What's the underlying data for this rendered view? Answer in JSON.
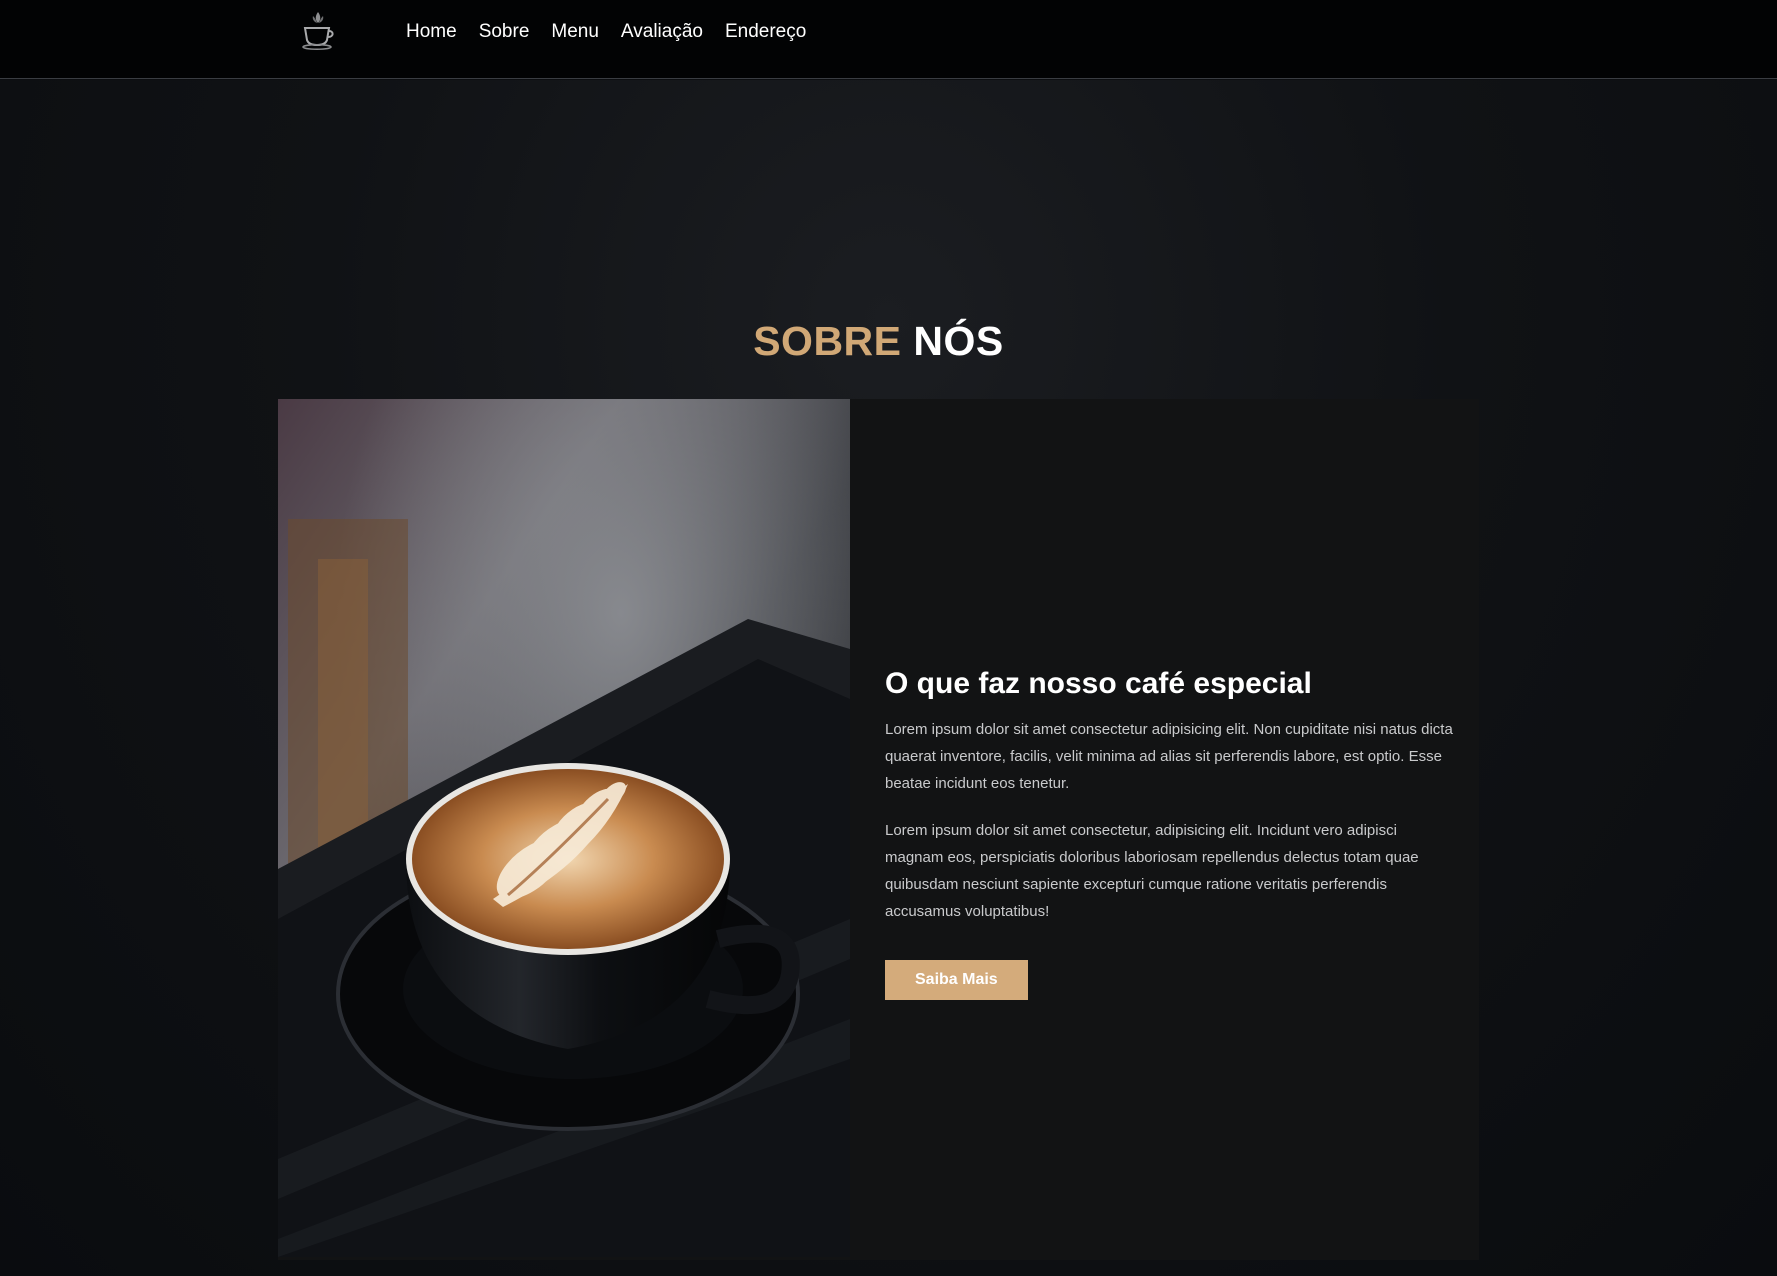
{
  "nav": {
    "items": [
      {
        "label": "Home"
      },
      {
        "label": "Sobre"
      },
      {
        "label": "Menu"
      },
      {
        "label": "Avaliação"
      },
      {
        "label": "Endereço"
      }
    ]
  },
  "about": {
    "title_accent": "SOBRE",
    "title_main": "NÓS",
    "headline": "O que faz nosso café especial",
    "paragraphs": [
      "Lorem ipsum dolor sit amet consectetur adipisicing elit. Non cupiditate nisi natus dicta quaerat inventore, facilis, velit minima ad alias sit perferendis labore, est optio. Esse beatae incidunt eos tenetur.",
      "Lorem ipsum dolor sit amet consectetur, adipisicing elit. Incidunt vero adipisci magnam eos, perspiciatis doloribus laboriosam repellendus delectus totam quae quibusdam nesciunt sapiente excepturi cumque ratione veritatis perferendis accusamus voluptatibus!"
    ],
    "cta_label": "Saiba Mais",
    "image_subject": "latte-art-coffee-cup"
  },
  "colors": {
    "accent": "#d4ab7b",
    "header_bg": "#020304",
    "card_bg": "#121314"
  }
}
